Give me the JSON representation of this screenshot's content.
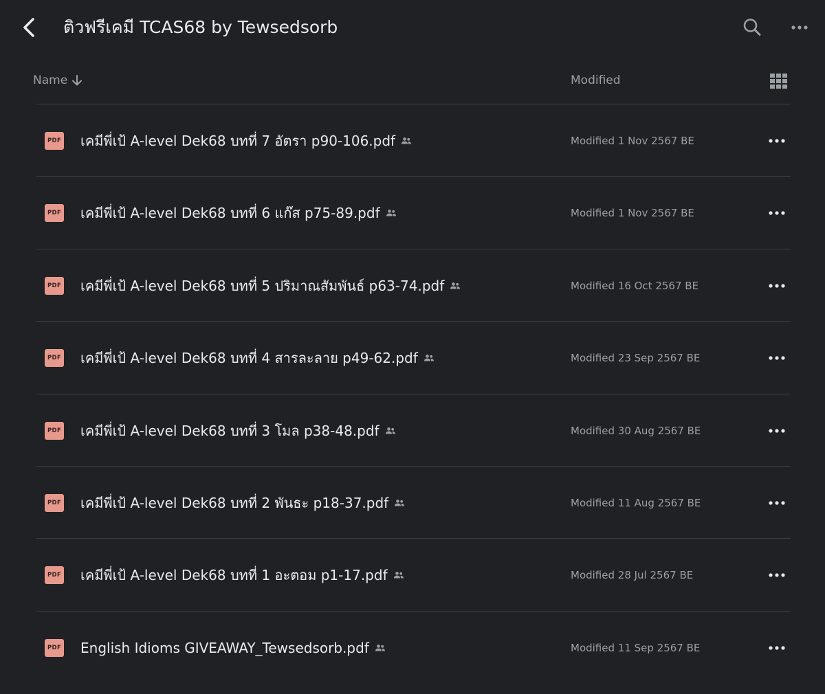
{
  "header": {
    "title": "ติวฟรีเคมี TCAS68 by Tewsedsorb"
  },
  "columns": {
    "name": "Name",
    "modified": "Modified"
  },
  "files": [
    {
      "name": "เคมีพี่เป้ A-level Dek68 บทที่ 7 อัตรา p90-106.pdf",
      "modified": "Modified 1 Nov 2567 BE",
      "icon": "pdf-icon",
      "shared": true
    },
    {
      "name": "เคมีพี่เป้ A-level Dek68 บทที่ 6 แก๊ส p75-89.pdf",
      "modified": "Modified 1 Nov 2567 BE",
      "icon": "pdf-icon",
      "shared": true
    },
    {
      "name": "เคมีพี่เป้ A-level Dek68 บทที่ 5 ปริมาณสัมพันธ์ p63-74.pdf",
      "modified": "Modified 16 Oct 2567 BE",
      "icon": "pdf-icon",
      "shared": true
    },
    {
      "name": "เคมีพี่เป้ A-level Dek68 บทที่ 4 สารละลาย p49-62.pdf",
      "modified": "Modified 23 Sep 2567 BE",
      "icon": "pdf-icon",
      "shared": true
    },
    {
      "name": "เคมีพี่เป้ A-level Dek68 บทที่ 3 โมล p38-48.pdf",
      "modified": "Modified 30 Aug 2567 BE",
      "icon": "pdf-icon",
      "shared": true
    },
    {
      "name": "เคมีพี่เป้ A-level Dek68 บทที่ 2 พันธะ p18-37.pdf",
      "modified": "Modified 11 Aug 2567 BE",
      "icon": "pdf-icon",
      "shared": true
    },
    {
      "name": "เคมีพี่เป้ A-level Dek68 บทที่ 1 อะตอม p1-17.pdf",
      "modified": "Modified 28 Jul 2567 BE",
      "icon": "pdf-icon",
      "shared": true
    },
    {
      "name": "English Idioms GIVEAWAY_Tewsedsorb.pdf",
      "modified": "Modified 11 Sep 2567 BE",
      "icon": "pdf-icon",
      "shared": true
    }
  ],
  "pdf_label": "PDF",
  "colors": {
    "background": "#202124",
    "text_primary": "#e8eaed",
    "text_secondary": "#9aa0a6",
    "pdf_icon": "#e8998d",
    "divider": "#3c4043"
  }
}
